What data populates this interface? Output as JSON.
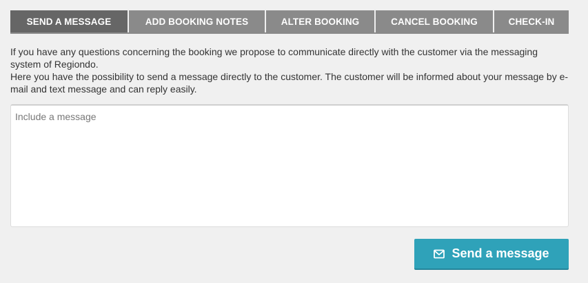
{
  "tabs": [
    {
      "label": "SEND A MESSAGE",
      "active": true
    },
    {
      "label": "ADD BOOKING NOTES",
      "active": false
    },
    {
      "label": "ALTER BOOKING",
      "active": false
    },
    {
      "label": "CANCEL BOOKING",
      "active": false
    },
    {
      "label": "CHECK-IN",
      "active": false
    }
  ],
  "description": {
    "line1": "If you have any questions concerning the booking we propose to communicate directly with the customer via the messaging system of Regiondo.",
    "line2": "Here you have the possibility to send a message directly to the customer. The customer will be informed about your message by e- mail and text message and can reply easily."
  },
  "message": {
    "placeholder": "Include a message",
    "value": ""
  },
  "send_button": {
    "label": "Send a message",
    "icon": "envelope-icon"
  },
  "colors": {
    "background": "#f0f0f0",
    "tab_inactive": "#8a8a8a",
    "tab_active": "#666666",
    "accent": "#2fa2b9"
  }
}
